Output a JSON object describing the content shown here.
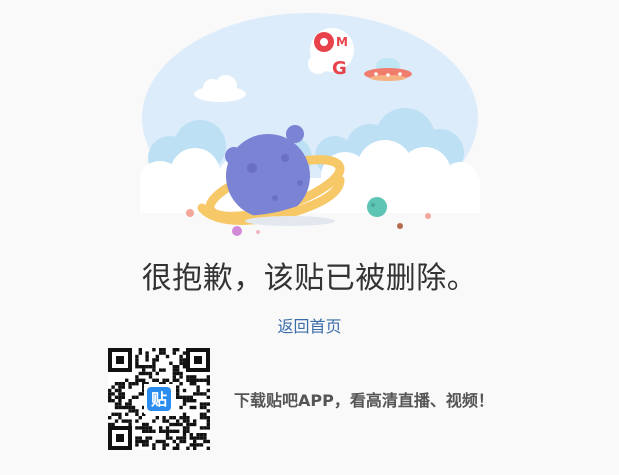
{
  "message": "很抱歉，该贴已被删除。",
  "back_link": "返回首页",
  "promo_text": "下载贴吧APP，看高清直播、视频！",
  "qr_badge": "贴",
  "illustration": {
    "omg_text": "OMG",
    "icon": "planet-ufo-illustration"
  },
  "colors": {
    "background": "#f9f9f9",
    "message": "#333333",
    "link": "#3a6da8",
    "promo": "#555555",
    "qr_badge": "#2b8cf0"
  }
}
